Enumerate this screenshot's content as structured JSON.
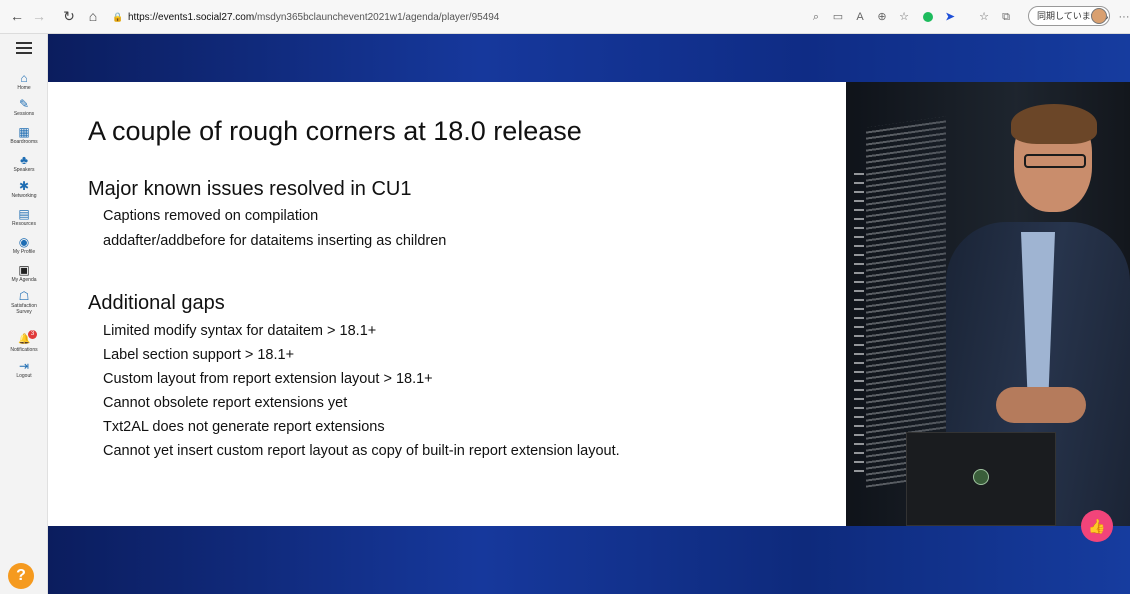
{
  "browser": {
    "url_host": "https://events1.social27.com",
    "url_path": "/msdyn365bclaunchevent2021w1/agenda/player/95494",
    "profile_label": "同期していません",
    "more": "···"
  },
  "sidebar": {
    "items": [
      {
        "label": "Home",
        "icon": "⌂"
      },
      {
        "label": "Sessions",
        "icon": "✎"
      },
      {
        "label": "Boardrooms",
        "icon": "▦"
      },
      {
        "label": "Speakers",
        "icon": "♣"
      },
      {
        "label": "Networking",
        "icon": "✱"
      },
      {
        "label": "Resources",
        "icon": "▤"
      },
      {
        "label": "My Profile",
        "icon": "◉"
      },
      {
        "label": "My Agenda",
        "icon": "▣"
      },
      {
        "label": "Satisfaction Survey",
        "icon": "☖"
      },
      {
        "label": "Notifications",
        "icon": "🔔"
      },
      {
        "label": "Logout",
        "icon": "⇥"
      }
    ],
    "notification_count": "3",
    "help_label": "?"
  },
  "slide": {
    "title": "A couple of rough corners at 18.0 release",
    "section1_heading": "Major known issues resolved in CU1",
    "section1_items": [
      "Captions removed on compilation",
      "addafter/addbefore for dataitems inserting as children"
    ],
    "section2_heading": "Additional gaps",
    "section2_items": [
      "Limited modify syntax for dataitem > 18.1+",
      "Label section support > 18.1+",
      "Custom layout from report extension layout > 18.1+",
      "Cannot obsolete report extensions yet",
      "Txt2AL does not generate report extensions",
      "Cannot yet insert custom report layout as copy of built-in report extension layout."
    ]
  },
  "colors": {
    "accent_blue": "#1e6db3",
    "like_pink": "#f2447a",
    "help_orange": "#f59a1f"
  }
}
